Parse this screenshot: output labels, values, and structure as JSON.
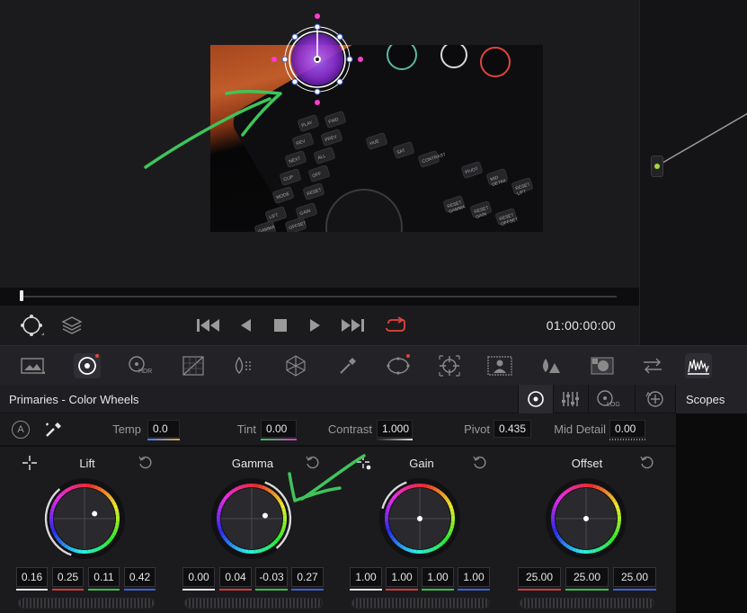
{
  "timecode": "01:00:00:00",
  "colors": {
    "accent": "#ffffff",
    "annotation": "#3fc45a",
    "record_loop": "#e0453a",
    "node_link": "#9fd93b"
  },
  "viewer": {
    "power_window_icon": "circle-power-window-icon",
    "control_panel_keys": [
      "PLAY",
      "FWD",
      "REV",
      "PREV",
      "NEXT",
      "ALL",
      "CLIP",
      "OFF",
      "MODE",
      "RESET",
      "LIFT",
      "GAIN",
      "GAMMA",
      "OFFSET",
      "HUE",
      "SAT",
      "CONTRAST",
      "PIVOT",
      "MID DETAIL",
      "RESET LIFT",
      "RESET GAMMA",
      "RESET GAIN",
      "RESET OFFSET",
      "BYPASS",
      "VIEWER",
      "CURSOR"
    ]
  },
  "transport": {
    "left_icons": [
      "viewer-mode-icon",
      "layers-icon"
    ],
    "controls": [
      "skip-to-start-icon",
      "play-reverse-icon",
      "stop-icon",
      "play-icon",
      "skip-to-end-icon",
      "loop-icon"
    ]
  },
  "palette": [
    {
      "name": "gallery",
      "dot": false,
      "active": false
    },
    {
      "name": "color-wheels",
      "dot": true,
      "active": true
    },
    {
      "name": "hdr",
      "label": "HDR",
      "dot": false,
      "active": false
    },
    {
      "name": "rgb-mixer",
      "dot": false,
      "active": false
    },
    {
      "name": "motion-effects",
      "dot": false,
      "active": false
    },
    {
      "name": "color-warper",
      "dot": false,
      "active": false
    },
    {
      "name": "qualifier",
      "dot": false,
      "active": false
    },
    {
      "name": "power-window",
      "dot": true,
      "active": false
    },
    {
      "name": "tracker",
      "dot": false,
      "active": false
    },
    {
      "name": "magic-mask",
      "dot": false,
      "active": false
    },
    {
      "name": "blur",
      "dot": false,
      "active": false
    },
    {
      "name": "key",
      "dot": false,
      "active": false
    },
    {
      "name": "sizing",
      "dot": false,
      "active": false
    },
    {
      "name": "scopes",
      "dot": false,
      "active": true
    }
  ],
  "color_wheels": {
    "title": "Primaries - Color Wheels",
    "modes": [
      "wheels-mode-icon",
      "bars-mode-icon",
      "log-mode-icon",
      "reset-all-icon"
    ],
    "log_label": "LOG",
    "params": [
      {
        "label": "Temp",
        "value": "0.0"
      },
      {
        "label": "Tint",
        "value": "0.00"
      },
      {
        "label": "Contrast",
        "value": "1.000"
      },
      {
        "label": "Pivot",
        "value": "0.435"
      },
      {
        "label": "Mid Detail",
        "value": "0.00"
      }
    ],
    "wheels": [
      {
        "title": "Lift",
        "values": [
          "0.16",
          "0.25",
          "0.11",
          "0.42"
        ],
        "dot_x": 0.33,
        "dot_y": -0.16,
        "arc_from": 200,
        "arc_to": 320
      },
      {
        "title": "Gamma",
        "values": [
          "0.00",
          "0.04",
          "-0.03",
          "0.27"
        ],
        "dot_x": 0.44,
        "dot_y": -0.1,
        "arc_from": 20,
        "arc_to": 140
      },
      {
        "title": "Gain",
        "values": [
          "1.00",
          "1.00",
          "1.00",
          "1.00"
        ],
        "dot_x": 0,
        "dot_y": 0,
        "arc_from": 285,
        "arc_to": 340
      },
      {
        "title": "Offset",
        "values": [
          "25.00",
          "25.00",
          "25.00"
        ],
        "dot_x": 0,
        "dot_y": 0,
        "arc_from": 0,
        "arc_to": 0
      }
    ]
  },
  "scopes": {
    "title": "Scopes"
  }
}
